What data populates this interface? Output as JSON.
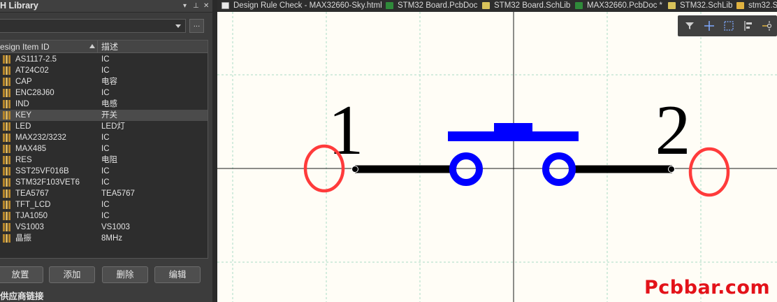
{
  "panel": {
    "title": "H Library",
    "ctrl_menu": "▾",
    "ctrl_pin": "⊥",
    "ctrl_close": "✕",
    "dots_label": "...",
    "columns": {
      "id": "esign Item ID",
      "desc": "描述"
    },
    "rows": [
      {
        "id": "AS1117-2.5",
        "desc": "IC"
      },
      {
        "id": "AT24C02",
        "desc": "IC"
      },
      {
        "id": "CAP",
        "desc": "电容"
      },
      {
        "id": "ENC28J60",
        "desc": "IC"
      },
      {
        "id": "IND",
        "desc": "电感"
      },
      {
        "id": "KEY",
        "desc": "开关"
      },
      {
        "id": "LED",
        "desc": "LED灯"
      },
      {
        "id": "MAX232/3232",
        "desc": "IC"
      },
      {
        "id": "MAX485",
        "desc": "IC"
      },
      {
        "id": "RES",
        "desc": "电阻"
      },
      {
        "id": "SST25VF016B",
        "desc": "IC"
      },
      {
        "id": "STM32F103VET6",
        "desc": "IC"
      },
      {
        "id": "TEA5767",
        "desc": "TEA5767"
      },
      {
        "id": "TFT_LCD",
        "desc": "IC"
      },
      {
        "id": "TJA1050",
        "desc": "IC"
      },
      {
        "id": "VS1003",
        "desc": "VS1003"
      },
      {
        "id": "晶振",
        "desc": "8MHz"
      }
    ],
    "selected_row": "KEY",
    "buttons": {
      "place": "放置",
      "add": "添加",
      "delete": "删除",
      "edit": "编辑"
    },
    "supplier_links": "供应商链接"
  },
  "tabs": [
    {
      "label": "Design Rule Check - MAX32660-Sky.html",
      "icon": "html-file-icon"
    },
    {
      "label": "STM32 Board.PcbDoc",
      "icon": "pcb-doc-icon"
    },
    {
      "label": "STM32 Board.SchLib",
      "icon": "schlib-icon"
    },
    {
      "label": "MAX32660.PcbDoc *",
      "icon": "pcb-doc-icon"
    },
    {
      "label": "STM32.SchLib",
      "icon": "schlib-icon"
    },
    {
      "label": "stm32.S",
      "icon": "folder-icon"
    }
  ],
  "schematic": {
    "pin1_label": "1",
    "pin2_label": "2",
    "body_color": "#0000ff",
    "pin_color": "#000000",
    "marker_color": "#ff3b3b"
  },
  "toolbar_icons": [
    "filter-icon",
    "crosshair-icon",
    "select-rect-icon",
    "align-icon",
    "pin-icon"
  ],
  "watermark": "Pcbbar.com"
}
